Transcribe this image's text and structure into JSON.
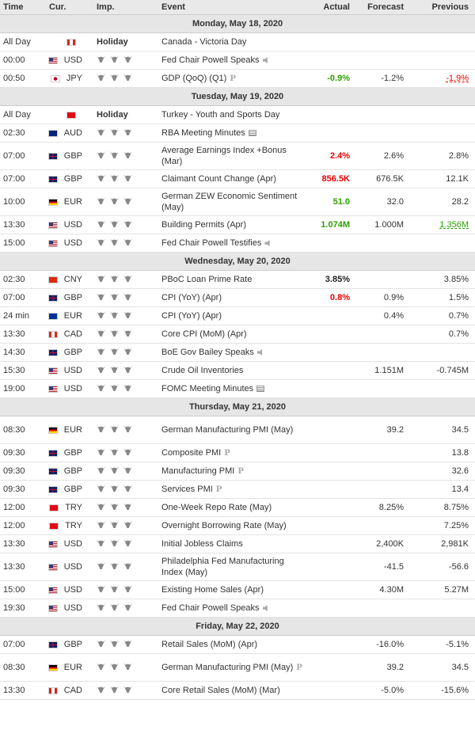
{
  "columns": {
    "time": "Time",
    "cur": "Cur.",
    "imp": "Imp.",
    "event": "Event",
    "actual": "Actual",
    "forecast": "Forecast",
    "previous": "Previous"
  },
  "days": [
    {
      "label": "Monday, May 18, 2020",
      "rows": [
        {
          "time": "All Day",
          "flag": "CAD",
          "cur": "",
          "imp": "Holiday",
          "event": "Canada - Victoria Day",
          "actual": "",
          "forecast": "",
          "previous": ""
        },
        {
          "time": "00:00",
          "flag": "USD",
          "cur": "USD",
          "imp": "bulls",
          "event": "Fed Chair Powell Speaks",
          "icon": "speaker",
          "actual": "",
          "forecast": "",
          "previous": ""
        },
        {
          "time": "00:50",
          "flag": "JPY",
          "cur": "JPY",
          "imp": "bulls",
          "event": "GDP (QoQ) (Q1)",
          "icon": "p",
          "actual": "-0.9%",
          "actualStyle": "g",
          "forecast": "-1.2%",
          "previous": "-1.9%",
          "previousStyle": "prevred"
        }
      ]
    },
    {
      "label": "Tuesday, May 19, 2020",
      "rows": [
        {
          "time": "All Day",
          "flag": "TRY",
          "cur": "",
          "imp": "Holiday",
          "event": "Turkey - Youth and Sports Day",
          "actual": "",
          "forecast": "",
          "previous": ""
        },
        {
          "time": "02:30",
          "flag": "AUD",
          "cur": "AUD",
          "imp": "bulls",
          "event": "RBA Meeting Minutes",
          "icon": "doc",
          "actual": "",
          "forecast": "",
          "previous": ""
        },
        {
          "time": "07:00",
          "flag": "GBP",
          "cur": "GBP",
          "imp": "bulls",
          "event": "Average Earnings Index +Bonus (Mar)",
          "tall": true,
          "actual": "2.4%",
          "actualStyle": "red",
          "forecast": "2.6%",
          "previous": "2.8%"
        },
        {
          "time": "07:00",
          "flag": "GBP",
          "cur": "GBP",
          "imp": "bulls",
          "event": "Claimant Count Change (Apr)",
          "actual": "856.5K",
          "actualStyle": "red",
          "forecast": "676.5K",
          "previous": "12.1K"
        },
        {
          "time": "10:00",
          "flag": "EUR_DE",
          "cur": "EUR",
          "imp": "bulls",
          "event": "German ZEW Economic Sentiment (May)",
          "tall": true,
          "actual": "51.0",
          "actualStyle": "g",
          "forecast": "32.0",
          "previous": "28.2"
        },
        {
          "time": "13:30",
          "flag": "USD",
          "cur": "USD",
          "imp": "bulls",
          "event": "Building Permits (Apr)",
          "actual": "1.074M",
          "actualStyle": "g",
          "forecast": "1.000M",
          "previous": "1.356M",
          "previousStyle": "prevgreen"
        },
        {
          "time": "15:00",
          "flag": "USD",
          "cur": "USD",
          "imp": "bulls",
          "event": "Fed Chair Powell Testifies",
          "icon": "speaker",
          "actual": "",
          "forecast": "",
          "previous": ""
        }
      ]
    },
    {
      "label": "Wednesday, May 20, 2020",
      "rows": [
        {
          "time": "02:30",
          "flag": "CNY",
          "cur": "CNY",
          "imp": "bulls",
          "event": "PBoC Loan Prime Rate",
          "actual": "3.85%",
          "actualStyle": "blk",
          "forecast": "",
          "previous": "3.85%"
        },
        {
          "time": "07:00",
          "flag": "GBP",
          "cur": "GBP",
          "imp": "bulls",
          "event": "CPI (YoY) (Apr)",
          "actual": "0.8%",
          "actualStyle": "red",
          "forecast": "0.9%",
          "previous": "1.5%"
        },
        {
          "time": "24 min",
          "flag": "EUR_EU",
          "cur": "EUR",
          "imp": "bulls",
          "event": "CPI (YoY) (Apr)",
          "actual": "",
          "forecast": "0.4%",
          "previous": "0.7%"
        },
        {
          "time": "13:30",
          "flag": "CAD",
          "cur": "CAD",
          "imp": "bulls",
          "event": "Core CPI (MoM) (Apr)",
          "actual": "",
          "forecast": "",
          "previous": "0.7%"
        },
        {
          "time": "14:30",
          "flag": "GBP",
          "cur": "GBP",
          "imp": "bulls",
          "event": "BoE Gov Bailey Speaks",
          "icon": "speaker",
          "actual": "",
          "forecast": "",
          "previous": ""
        },
        {
          "time": "15:30",
          "flag": "USD",
          "cur": "USD",
          "imp": "bulls",
          "event": "Crude Oil Inventories",
          "actual": "",
          "forecast": "1.151M",
          "previous": "-0.745M"
        },
        {
          "time": "19:00",
          "flag": "USD",
          "cur": "USD",
          "imp": "bulls",
          "event": "FOMC Meeting Minutes",
          "icon": "doc",
          "actual": "",
          "forecast": "",
          "previous": ""
        }
      ]
    },
    {
      "label": "Thursday, May 21, 2020",
      "rows": [
        {
          "time": "08:30",
          "flag": "EUR_DE",
          "cur": "EUR",
          "imp": "bulls",
          "event": "German Manufacturing PMI (May)",
          "tall": true,
          "actual": "",
          "forecast": "39.2",
          "previous": "34.5"
        },
        {
          "time": "09:30",
          "flag": "GBP",
          "cur": "GBP",
          "imp": "bulls",
          "event": "Composite PMI",
          "icon": "p",
          "actual": "",
          "forecast": "",
          "previous": "13.8"
        },
        {
          "time": "09:30",
          "flag": "GBP",
          "cur": "GBP",
          "imp": "bulls",
          "event": "Manufacturing PMI",
          "icon": "p",
          "actual": "",
          "forecast": "",
          "previous": "32.6"
        },
        {
          "time": "09:30",
          "flag": "GBP",
          "cur": "GBP",
          "imp": "bulls",
          "event": "Services PMI",
          "icon": "p",
          "actual": "",
          "forecast": "",
          "previous": "13.4"
        },
        {
          "time": "12:00",
          "flag": "TRY",
          "cur": "TRY",
          "imp": "bulls",
          "event": "One-Week Repo Rate (May)",
          "actual": "",
          "forecast": "8.25%",
          "previous": "8.75%"
        },
        {
          "time": "12:00",
          "flag": "TRY",
          "cur": "TRY",
          "imp": "bulls",
          "event": "Overnight Borrowing Rate (May)",
          "actual": "",
          "forecast": "",
          "previous": "7.25%"
        },
        {
          "time": "13:30",
          "flag": "USD",
          "cur": "USD",
          "imp": "bulls",
          "event": "Initial Jobless Claims",
          "actual": "",
          "forecast": "2,400K",
          "previous": "2,981K"
        },
        {
          "time": "13:30",
          "flag": "USD",
          "cur": "USD",
          "imp": "bulls",
          "event": "Philadelphia Fed Manufacturing Index (May)",
          "tall": true,
          "actual": "",
          "forecast": "-41.5",
          "previous": "-56.6"
        },
        {
          "time": "15:00",
          "flag": "USD",
          "cur": "USD",
          "imp": "bulls",
          "event": "Existing Home Sales (Apr)",
          "actual": "",
          "forecast": "4.30M",
          "previous": "5.27M"
        },
        {
          "time": "19:30",
          "flag": "USD",
          "cur": "USD",
          "imp": "bulls",
          "event": "Fed Chair Powell Speaks",
          "icon": "speaker",
          "actual": "",
          "forecast": "",
          "previous": ""
        }
      ]
    },
    {
      "label": "Friday, May 22, 2020",
      "rows": [
        {
          "time": "07:00",
          "flag": "GBP",
          "cur": "GBP",
          "imp": "bulls",
          "event": "Retail Sales (MoM) (Apr)",
          "actual": "",
          "forecast": "-16.0%",
          "previous": "-5.1%"
        },
        {
          "time": "08:30",
          "flag": "EUR_DE",
          "cur": "EUR",
          "imp": "bulls",
          "event": "German Manufacturing PMI (May)",
          "icon": "p",
          "tall": true,
          "actual": "",
          "forecast": "39.2",
          "previous": "34.5"
        },
        {
          "time": "13:30",
          "flag": "CAD",
          "cur": "CAD",
          "imp": "bulls",
          "event": "Core Retail Sales (MoM) (Mar)",
          "actual": "",
          "forecast": "-5.0%",
          "previous": "-15.6%"
        }
      ]
    }
  ]
}
